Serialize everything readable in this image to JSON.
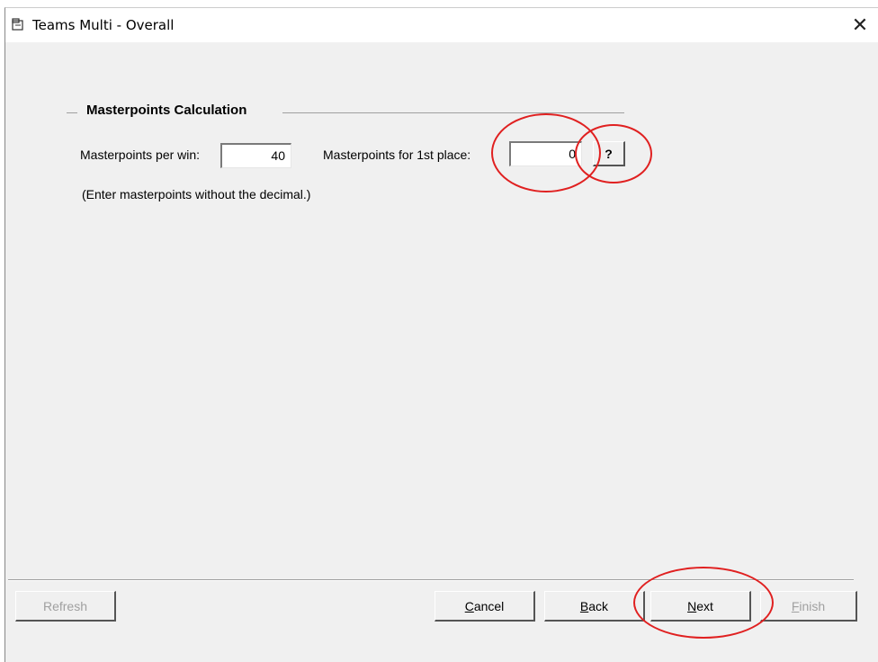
{
  "window": {
    "title": "Teams Multi - Overall",
    "close_glyph": "✕",
    "icon": "window-app-icon"
  },
  "group": {
    "title": "Masterpoints Calculation"
  },
  "fields": {
    "per_win_label": "Masterpoints per win:",
    "per_win_value": "40",
    "first_place_label": "Masterpoints for 1st place:",
    "first_place_value": "0",
    "help_label": "?"
  },
  "hint": "(Enter masterpoints without the decimal.)",
  "buttons": {
    "refresh": "Refresh",
    "cancel_u": "C",
    "cancel_rest": "ancel",
    "back_u": "B",
    "back_rest": "ack",
    "next_u": "N",
    "next_rest": "ext",
    "finish_u": "F",
    "finish_rest": "inish"
  },
  "colors": {
    "annotation_red": "#e02020",
    "dialog_bg": "#f0f0f0"
  }
}
